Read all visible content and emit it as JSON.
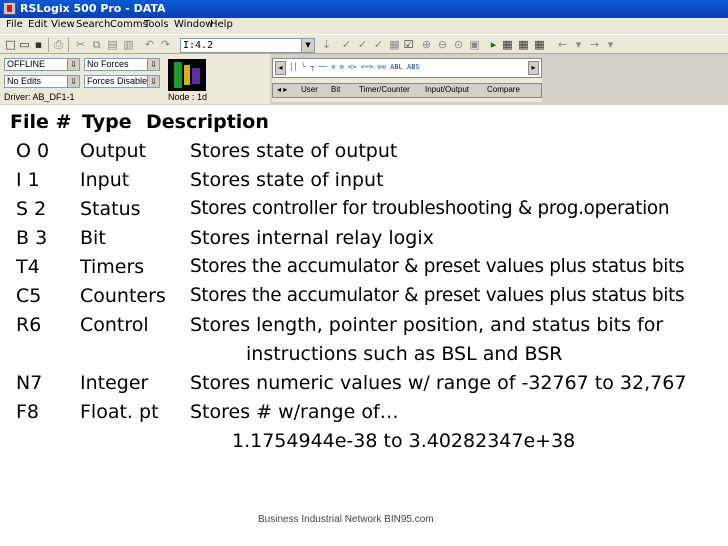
{
  "window": {
    "title": "RSLogix 500 Pro - DATA"
  },
  "menu": [
    "File",
    "Edit",
    "View",
    "Search",
    "Comms",
    "Tools",
    "Window",
    "Help"
  ],
  "toolbar": {
    "address_value": "I:4.2"
  },
  "status": {
    "mode": "OFFLINE",
    "forces": "No Forces",
    "edits": "No Edits",
    "forces_enabled": "Forces Disabled",
    "driver": "Driver: AB_DF1-1",
    "node": "Node : 1d"
  },
  "palette": {
    "instructions": "││ └ ┬ ── ⊙ ⊙ <> <─> ⊙⊙ ABL ABS",
    "tabs": [
      "User",
      "Bit",
      "Timer/Counter",
      "Input/Output",
      "Compare"
    ]
  },
  "slide": {
    "header": {
      "file": "File #",
      "type": "Type",
      "desc": "Description"
    },
    "rows": [
      {
        "file": "O 0",
        "type": "Output",
        "desc": "Stores state of output"
      },
      {
        "file": "I  1",
        "type": "Input",
        "desc": "Stores state of input"
      },
      {
        "file": "S 2",
        "type": "Status",
        "desc": "Stores controller for troubleshooting & prog.operation"
      },
      {
        "file": "B 3",
        "type": "Bit",
        "desc": "Stores internal relay logix"
      },
      {
        "file": "T4",
        "type": "Timers",
        "desc": "Stores the accumulator & preset values plus status bits"
      },
      {
        "file": "C5",
        "type": "Counters",
        "desc": "Stores the accumulator & preset values plus status bits"
      },
      {
        "file": "R6",
        "type": "Control",
        "desc": "Stores length, pointer position, and status bits for"
      },
      {
        "file": "N7",
        "type": "Integer",
        "desc": "Stores numeric values w/ range of -32767 to 32,767"
      },
      {
        "file": "F8",
        "type": "Float. pt",
        "desc": "Stores # w/range of…"
      }
    ],
    "r6_cont": "instructions such as BSL and BSR",
    "f8_cont": "1.1754944e-38   to 3.40282347e+38",
    "footer": "Business Industrial Network       BIN95.com"
  }
}
